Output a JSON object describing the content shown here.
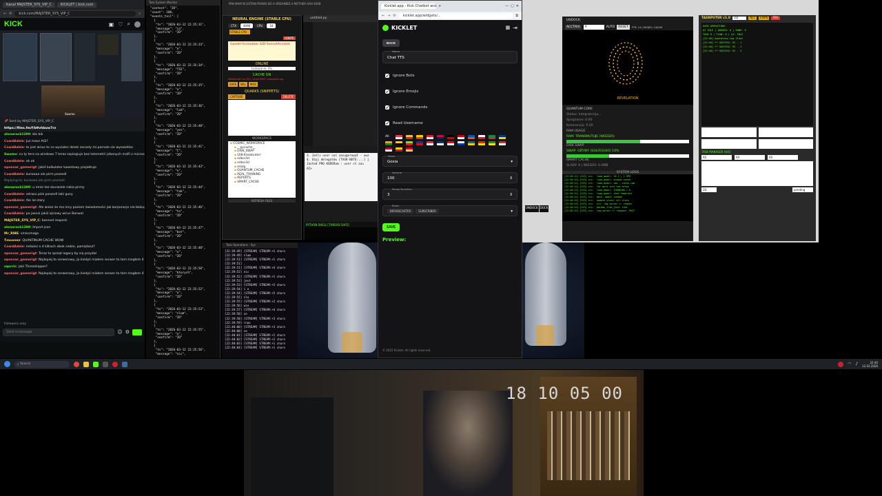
{
  "browser_left": {
    "tabs": [
      "Kanał MAJSTER_SYS_VIP_C",
      "KICKLET | kick.com"
    ],
    "url": "kick.com/MAJSTER_SYS_VIP_C",
    "logo": "KICK"
  },
  "webcam_small": {
    "name": "Swomo"
  },
  "chat": {
    "header": "Sent by MAJSTER_SYS_VIP_C",
    "link": "https://files.fm/f/b9vhbuw7rz",
    "messages": [
      {
        "user": "alonarock1200",
        "text": "bik bik",
        "color": "#53fc18"
      },
      {
        "user": "CowdAdele",
        "text": "Już masz AGI?",
        "color": "#ff6b6b"
      },
      {
        "user": "CowdAdele",
        "text": "to jest wirus to co wysiałes dzieki zaczely mi pornole sie wyswietlac",
        "color": "#ff6b6b"
      },
      {
        "user": "Swomo",
        "text": "co ty tera na windows 7 teraz szpiegiuje bez telemetrii jebanych mafii z microsoftu?",
        "color": "#53fc18"
      },
      {
        "user": "CowdAdele",
        "text": "ok ok",
        "color": "#ff6b6b"
      },
      {
        "user": "eponxar_gamerigt",
        "text": "Jakiś kalkulator kwantowy projektuje",
        "color": "#ff6b6b"
      },
      {
        "user": "CowdAdele",
        "text": "kurwaaa ale pirm poszedl",
        "color": "#ff6b6b"
      },
      {
        "user": "",
        "text": "Replying to: kurwaaa ale pirm poszedl",
        "color": "#888"
      },
      {
        "user": "alonarock1200",
        "text": "u mnie tez skurwiele robia pirmy",
        "color": "#53fc18"
      },
      {
        "user": "CowdAdele",
        "text": "odrazu pisk poszedl taki gucy",
        "color": "#ff6b6b"
      },
      {
        "user": "CowdAdele",
        "text": "Ale lal stary",
        "color": "#ff6b6b"
      },
      {
        "user": "eponxar_gamerigt",
        "text": "Ale wiesz że ma inny poziom świadomości jak korporacje nie blokują",
        "color": "#ff6b6b"
      },
      {
        "user": "CowdAdele",
        "text": "po jasnoi jakiś ojciowy wirus Banwal",
        "color": "#ff6b6b"
      },
      {
        "user": "MAJSTER_SYS_VIP_C",
        "text": "banned reaperk",
        "color": "#ffd84d"
      },
      {
        "user": "alonarock1200",
        "text": "Import json",
        "color": "#53fc18"
      },
      {
        "user": "Mr_RIBE",
        "text": "smacznego",
        "color": "#ffd84d"
      },
      {
        "user": "Tmoonez",
        "text": "QUANTINUM CACHE WOW",
        "color": "#ffd84d"
      },
      {
        "user": "CowdAdele",
        "text": "mówisz o 4 kilkach obok siebie, pamiętasz?",
        "color": "#ff6b6b"
      },
      {
        "user": "eponxar_gamerigt",
        "text": "Teraz to sprzęt legacy by się przydał",
        "color": "#ff6b6b"
      },
      {
        "user": "eponxar_gamerigt",
        "text": "Najlepiej to serwerowy, Ja kiedyś miałem serwer to tam mogłem 4 procesory zamontować",
        "color": "#ff6b6b"
      },
      {
        "user": "sqorric",
        "text": "Jaki Threadripper?",
        "color": "#53fc18"
      },
      {
        "user": "eponxar_gamerigt",
        "text": "Najlepiej to serwerowy, Ja kiedyś miałem serwer to tam mogłem 4 procesory zamontować",
        "color": "#ff6b6b"
      }
    ],
    "followers_only": "Followers only",
    "send_placeholder": "Send a message"
  },
  "json_window": {
    "title": "Task System Monitor",
    "lines": [
      "\"context\": \"2D\",",
      "\"count\": 100,",
      "\"events_tail\": [",
      "  {",
      "   \"ts\": \"2026-03-12 22:35:31\",",
      "   \"message\": \"co\",",
      "   \"confirm\": \"2D\"",
      "  },",
      "  {",
      "   \"ts\": \"2026-03-12 22:35:33\",",
      "   \"message\": \"o\",",
      "   \"confirm\": \"2D\"",
      "  },",
      "  {",
      "   \"ts\": \"2026-03-12 22:35:34\",",
      "   \"message\": \"TIE\",",
      "   \"confirm\": \"2D\"",
      "  },",
      "  {",
      "   \"ts\": \"2026-03-12 22:35:35\",",
      "   \"message\": \"o\",",
      "   \"confirm\": \"2D\"",
      "  },",
      "  {",
      "   \"ts\": \"2026-03-12 22:35:36\",",
      "   \"message\": \"lod\",",
      "   \"confirm\": \"2D\"",
      "  },",
      "  {",
      "   \"ts\": \"2026-03-12 22:35:40\",",
      "   \"message\": \"yes\",",
      "   \"confirm\": \"2D\"",
      "  },",
      "  {",
      "   \"ts\": \"2026-03-12 22:35:41\",",
      "   \"message\": \"C\",",
      "   \"confirm\": \"2D\"",
      "  },",
      "  {",
      "   \"ts\": \"2026-03-12 22:35:43\",",
      "   \"message\": \"o\",",
      "   \"confirm\": \"2D\"",
      "  },",
      "  {",
      "   \"ts\": \"2026-03-12 22:35:44\",",
      "   \"message\": \"tak\",",
      "   \"confirm\": \"2D\"",
      "  },",
      "  {",
      "   \"ts\": \"2026-03-12 22:35:46\",",
      "   \"message\": \"to\",",
      "   \"confirm\": \"2D\"",
      "  },",
      "  {",
      "   \"ts\": \"2026-03-12 22:35:47\",",
      "   \"message\": \"bot\",",
      "   \"confirm\": \"2D\"",
      "  },",
      "  {",
      "   \"ts\": \"2026-03-12 22:35:48\",",
      "   \"message\": \"o\",",
      "   \"confirm\": \"2D\"",
      "  },",
      "  {",
      "   \"ts\": \"2026-03-12 22:35:50\",",
      "   \"message\": \"ktorych\",",
      "   \"confirm\": \"2D\"",
      "  },",
      "  {",
      "   \"ts\": \"2026-03-12 22:35:52\",",
      "   \"message\": \"o\",",
      "   \"confirm\": \"2D\"",
      "  },",
      "  {",
      "   \"ts\": \"2026-03-12 22:35:53\",",
      "   \"message\": \"slum\",",
      "   \"confirm\": \"2D\"",
      "  },",
      "  {",
      "   \"ts\": \"2026-03-12 22:35:55\",",
      "   \"message\": \"o\",",
      "   \"confirm\": \"2D\"",
      "  },",
      "  {",
      "   \"ts\": \"2026-03-12 22:35:56\",",
      "   \"message\": \"nic\","
    ]
  },
  "neural_panel": {
    "title": "NEURAL ENGINE (STABLE CPU)",
    "chips": [
      "CTX",
      "4096",
      "CPU",
      "16"
    ],
    "stable": "STABLE CPU",
    "ignite": "IGNITE",
    "model": "Goedel-Formalizer-32B-SonnetAnnotat",
    "online": "ONLINE",
    "loading": "Ładowanie: 0%",
    "cache_on": "CACHE ON",
    "cache_info": "Wiadomość na CPU | cache RAM | Ładowanie ogr.",
    "modes": [
      "SAFE",
      "BAL",
      "MAX"
    ],
    "quarks": "QUARKS (SNIPPETS)",
    "capture": "CAPTURE",
    "delete": "DELETE",
    "workspace": "WORKSPACE",
    "tree": [
      "COSMIC_WORKSPACE",
      "__pycache__",
      "DISK_SWAP",
      "I2I8-Kreatorator",
      "edkor3d",
      "edkor3d",
      "mózg",
      "QUANTUM_CACHE",
      "REAL_TRAINING",
      "REPORTS",
      "SMART_CACHE"
    ],
    "refresh": "REFRESH FILES"
  },
  "editor": {
    "title": "PAN MAM W OSTANI MOWIS BO A ORDAINED A MOTHER AAH 4008",
    "file": "untitled.py",
    "console_lines": [
      "3. Jeśli user coś zasugerował - uwz",
      "",
      "4. Użyj delegatów [TASK-NOTE:...] j",
      "",
      "",
      "Jasted PRO KODERam : user ct zau",
      "AI>"
    ],
    "python_shell": "PYTHON SHELL [THREAD SAFE]",
    "shell_chips": [
      "GUI"
    ]
  },
  "stream_term": {
    "title": "Task Operations - Sys",
    "lines": [
      "[22:39:49] [STREAM] STREAM:+1 chars",
      "[22:39:49] slum",
      "[22:39:51] [STREAM] STREAM:+1 chars",
      "[22:39:51] .",
      "[22:39:51] [STREAM] STREAM:+4 chars",
      "[22:39:52] nic",
      "[22:39:52] [STREAM] STREAM:+1 chars",
      "[22:39:53] jest",
      "[22:39:53] [STREAM] STREAM:+5 chars",
      "[22:39:54] i o",
      "[22:39:54] [STREAM] STREAM:+5 chars",
      "[22:39:55] zle",
      "[22:39:55] [STREAM] STREAM:+2 chars",
      "[22:39:56] wie",
      "[22:39:57] [STREAM] STREAM:+4 chars",
      "[22:39:58] ze",
      "[22:39:58] [STREAM] STREAM:+3 chars",
      "[22:39:59] rnas",
      "[22:40:00] [STREAM] STREAM:+3 chars",
      "[22:40:00] se",
      "[22:40:01] [STREAM] STREAM:+1 chars",
      "[22:40:02] [STREAM] STREAM:+2 chars",
      "[22:40:03] [STREAM] STREAM:+1 chars",
      "[22:40:04] [STREAM] STREAM:+1 chars"
    ]
  },
  "kicklet": {
    "tab": "Kicklet.app - Kick Chatbot and...",
    "url": "kicklet.app/widgets/...",
    "brand": "KICKLET",
    "back": "BACK",
    "name_label": "Name",
    "name_value": "Chat TTS",
    "options": [
      {
        "label": "Ignore Bots",
        "checked": true
      },
      {
        "label": "Ignore Emojis",
        "checked": true
      },
      {
        "label": "Ignore Commands",
        "checked": true
      },
      {
        "label": "Read Username",
        "checked": true
      }
    ],
    "flag_all": "All",
    "voice_label": "Voice",
    "voice_value": "Gosia",
    "volume_label": "Volume",
    "volume_value": "100",
    "pause_label": "Pause Duration",
    "pause_value": "3",
    "roles_label": "Roles",
    "roles": [
      "BROADCASTER",
      "SUBSCRIBER"
    ],
    "save": "SAVE",
    "preview": "Preview:",
    "footer": "© 2025 Kicklet. All rights reserved."
  },
  "quantum_panel": {
    "undock": "UNDOCK",
    "actrix": "ACCTRIX",
    "a_field": "A",
    "auto": "AUTO",
    "reset": "RESET",
    "info": "FTR: 14 | MODEL: CACHE",
    "revelation": "REVELATION",
    "quantum_core": "QUANTUM CORE",
    "status": "Status: Integralnicja...",
    "sprzplanie": "Sprzplanie: 0.00",
    "koherencja": "Koherencja: 0.00",
    "ram_usage": "RAM USAGE",
    "ram_text": "RAM: TRANSMUTUJE (WIEDZA)",
    "ram_level": 0.6,
    "disk_swap": "DISK SWAP",
    "swap_text": "SWAP: OŻYWY (SOLFEGGIO) 10%",
    "swap_level": 0.35,
    "smart_cache": "SMART CACHE",
    "smart_text": "SLADY: 6 | WIEDZA: 0.0MB",
    "system_logs": "SYSTEM LOGS",
    "logs": [
      "[22:40:12] [SYS] src:  load_model: ID 2 | 1 GPU ",
      "[22:40:12] [SYS] src:  load_model: prompt cache",
      "[22:40:12] [SYS] src:  load_model: use --cache-ram",
      "[22:40:12] [SYS] src:  for more info see https",
      "[22:40:12] [SYS] src:  load_model: THINKING = 0",
      "[22:40:12] [SYS] src:  load_model: chat template",
      "[22:40:12] [SYS] src:  main: model loaded",
      "[22:40:12] [SYS] src:  update_slots: all slots",
      "[22:40:12] [SYS] src:  srv: log_server_r: reques",
      "[22:40:12] [SYS] srv:  params_from_json: Chat",
      "[22:40:12] [SYS] srv:  log_server_r: request: POST"
    ],
    "undock2": "UNDOCK",
    "dock": "DOCK"
  },
  "taskputer": {
    "title": "TASKPUTER v1.0",
    "field": "2D",
    "chips": [
      "ALT",
      "CAPS",
      "TRY"
    ],
    "lines": [
      "USER OPERATIONS",
      "AI IDLE | QUEUED: 0 | DONE: 0",
      "TASK 0 | FLOW: 0 | AI: IDLE",
      "[22:40] Operation Log Clear",
      "[22:40] ** SUCCESS: RC - 1",
      "[22:40] ** SUCCESS: RC - 2",
      "[22:40] ** SUCCESS: RC - 3"
    ],
    "task_manager": "TASK MANAGER [6/6]",
    "filters": [
      "All",
      "All",
      "All"
    ],
    "pending": "pending",
    "qty": "2D"
  },
  "webcam": {
    "timestamp": "18 10 05 00"
  },
  "taskbar": {
    "search": "Search",
    "time": "22:40",
    "date": "12.03.2026"
  }
}
